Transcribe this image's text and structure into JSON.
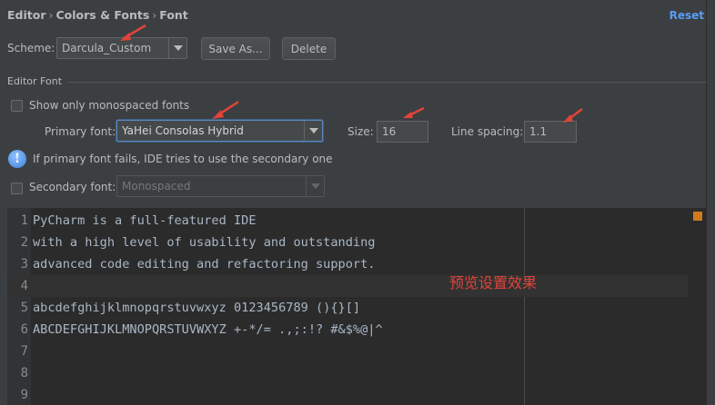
{
  "breadcrumb": {
    "items": [
      "Editor",
      "Colors & Fonts",
      "Font"
    ],
    "separator": "›"
  },
  "reset_label": "Reset",
  "scheme": {
    "label": "Scheme:",
    "value": "Darcula_Custom",
    "save_as_label": "Save As...",
    "delete_label": "Delete"
  },
  "editor_font": {
    "section_title": "Editor Font",
    "show_mono_label": "Show only monospaced fonts",
    "show_mono_checked": false,
    "primary_label": "Primary font:",
    "primary_value": "YaHei Consolas Hybrid",
    "size_label": "Size:",
    "size_value": "16",
    "line_spacing_label": "Line spacing:",
    "line_spacing_value": "1.1",
    "info_text": "If primary font fails, IDE tries to use the secondary one",
    "secondary_label": "Secondary font:",
    "secondary_value": "Monospaced",
    "secondary_checked": false
  },
  "preview": {
    "lines": [
      {
        "num": "1",
        "text": "PyCharm is a full-featured IDE"
      },
      {
        "num": "2",
        "text": "with a high level of usability and outstanding"
      },
      {
        "num": "3",
        "text": "advanced code editing and refactoring support."
      },
      {
        "num": "4",
        "text": ""
      },
      {
        "num": "5",
        "text": "abcdefghijklmnopqrstuvwxyz 0123456789 (){}[]"
      },
      {
        "num": "6",
        "text": "ABCDEFGHIJKLMNOPQRSTUVWXYZ +-*/= .,;:!? #&$%@|^"
      },
      {
        "num": "7",
        "text": ""
      },
      {
        "num": "8",
        "text": ""
      },
      {
        "num": "9",
        "text": ""
      }
    ],
    "annotation": "预览设置效果"
  },
  "colors": {
    "accent": "#589df6",
    "annotation": "#e0443a",
    "marker": "#d07a1d"
  }
}
